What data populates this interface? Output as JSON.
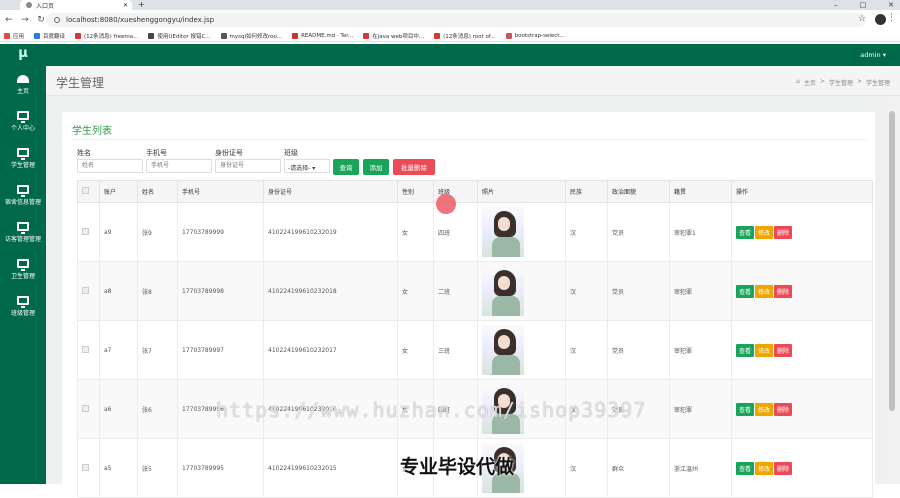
{
  "browser": {
    "tab_title": "入口页",
    "url": "localhost:8080/xueshenggongyu/index.jsp",
    "bookmarks": [
      "应用",
      "百度翻译",
      "(12条消息) freema...",
      "使用UEditor 报错C...",
      "mysql如何修改roo...",
      "README.md · Ter...",
      "在java web项目中...",
      "(12条消息) root of...",
      "bootstrap-select..."
    ]
  },
  "sidebar": {
    "logo": "μ",
    "items": [
      {
        "label": "主页",
        "icon": "dashboard-icon"
      },
      {
        "label": "个人中心",
        "icon": "monitor-icon"
      },
      {
        "label": "学生管理",
        "icon": "monitor-icon"
      },
      {
        "label": "宿舍信息管理",
        "icon": "monitor-icon"
      },
      {
        "label": "访客管理管理",
        "icon": "monitor-icon"
      },
      {
        "label": "卫生管理",
        "icon": "monitor-icon"
      },
      {
        "label": "班级管理",
        "icon": "monitor-icon"
      }
    ]
  },
  "topbar": {
    "user": "admin ▾"
  },
  "header": {
    "title": "学生管理",
    "breadcrumb": [
      "主页",
      "学生管理",
      "学生管理"
    ]
  },
  "panel": {
    "title": "学生列表"
  },
  "filters": {
    "name_label": "姓名",
    "name_placeholder": "姓名",
    "phone_label": "手机号",
    "phone_placeholder": "手机号",
    "id_label": "身份证号",
    "id_placeholder": "身份证号",
    "class_label": "班级",
    "class_selected": "-请选择-",
    "search_btn": "查询",
    "add_btn": "添加",
    "batch_delete_btn": "批量删除"
  },
  "table": {
    "headers": [
      "账户",
      "姓名",
      "手机号",
      "身份证号",
      "性别",
      "班级",
      "照片",
      "民族",
      "政治面貌",
      "籍贯",
      "操作"
    ],
    "actions": {
      "view": "查看",
      "edit": "修改",
      "delete": "删除"
    },
    "rows": [
      {
        "account": "a9",
        "name": "张9",
        "phone": "17703789999",
        "idno": "410224199610232019",
        "gender": "女",
        "class": "四班",
        "ethnic": "汉",
        "political": "党员",
        "origin": "审犯罪1"
      },
      {
        "account": "a8",
        "name": "张8",
        "phone": "17703789998",
        "idno": "410224199610232018",
        "gender": "女",
        "class": "二班",
        "ethnic": "汉",
        "political": "党员",
        "origin": "审犯罪"
      },
      {
        "account": "a7",
        "name": "张7",
        "phone": "17703789997",
        "idno": "410224199610232017",
        "gender": "女",
        "class": "三班",
        "ethnic": "汉",
        "political": "党员",
        "origin": "审犯罪"
      },
      {
        "account": "a6",
        "name": "张6",
        "phone": "17703789996",
        "idno": "410224199610232016",
        "gender": "女",
        "class": "四班",
        "ethnic": "汉",
        "political": "党员",
        "origin": "审犯罪"
      },
      {
        "account": "a5",
        "name": "张5",
        "phone": "17703789995",
        "idno": "410224199610232015",
        "gender": "女",
        "class": "一班",
        "ethnic": "汉",
        "political": "群众",
        "origin": "浙江温州"
      }
    ]
  },
  "overlay": {
    "watermark": "https://www.huzhan.com/ishop39397",
    "promo": "专业毕设代做"
  }
}
